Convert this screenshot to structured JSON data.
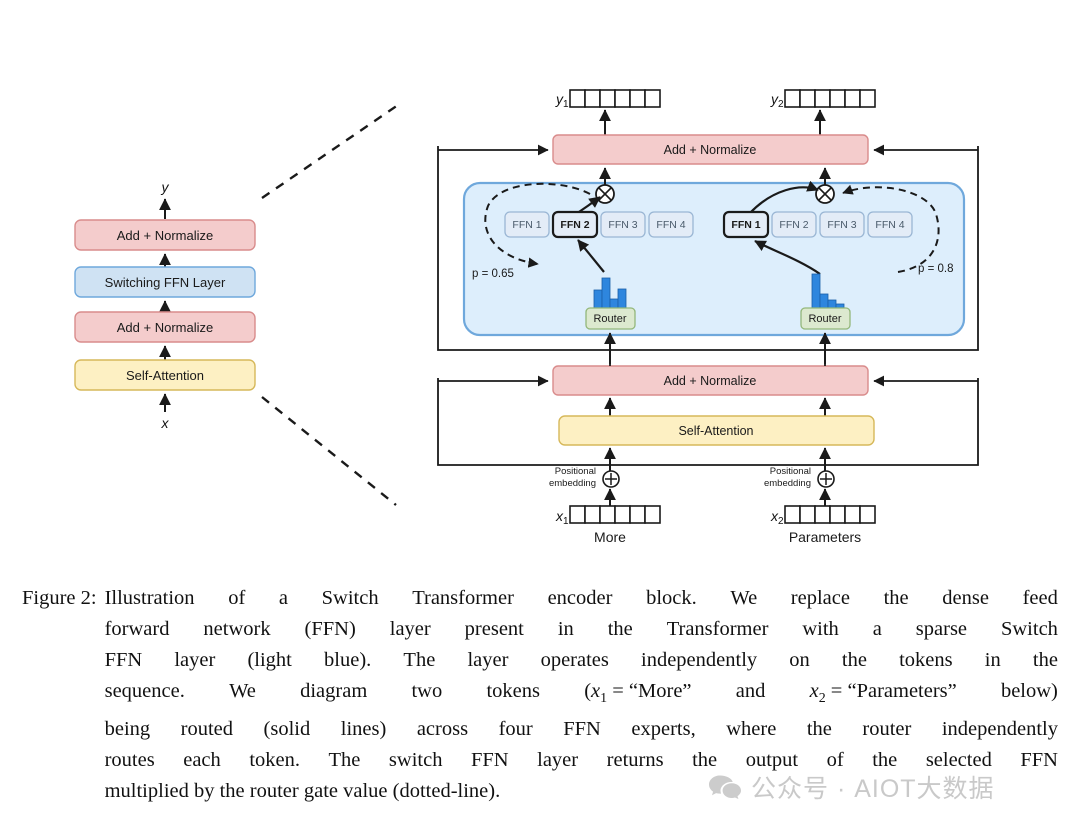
{
  "figure": {
    "left_diagram": {
      "output_label": "y",
      "input_label": "x",
      "blocks": [
        {
          "label": "Add + Normalize",
          "color": "#f4cccc"
        },
        {
          "label": "Switching FFN Layer",
          "color": "#cfe2f3"
        },
        {
          "label": "Add + Normalize",
          "color": "#f4cccc"
        },
        {
          "label": "Self-Attention",
          "color": "#fdf0c3"
        }
      ]
    },
    "right_diagram": {
      "outputs": [
        {
          "label": "y",
          "sub": "1",
          "cells": 6
        },
        {
          "label": "y",
          "sub": "2",
          "cells": 6
        }
      ],
      "inputs": [
        {
          "label": "x",
          "sub": "1",
          "cells": 6,
          "token": "More"
        },
        {
          "label": "x",
          "sub": "2",
          "cells": 6,
          "token": "Parameters"
        }
      ],
      "top_add_norm": "Add + Normalize",
      "bottom_add_norm": "Add + Normalize",
      "self_attention": "Self-Attention",
      "positional_embedding": [
        "Positional",
        "embedding"
      ],
      "router_label": "Router",
      "switch_ffn_layer_color": "#ddeefc",
      "experts_left": [
        {
          "label": "FFN 1",
          "selected": false
        },
        {
          "label": "FFN 2",
          "selected": true
        },
        {
          "label": "FFN 3",
          "selected": false
        },
        {
          "label": "FFN 4",
          "selected": false
        }
      ],
      "experts_right": [
        {
          "label": "FFN 1",
          "selected": true
        },
        {
          "label": "FFN 2",
          "selected": false
        },
        {
          "label": "FFN 3",
          "selected": false
        },
        {
          "label": "FFN 4",
          "selected": false
        }
      ],
      "gate_left": "p = 0.65",
      "gate_right": "p = 0.8",
      "router_hist_left": [
        0.55,
        1.0,
        0.28,
        0.62
      ],
      "router_hist_right": [
        1.0,
        0.4,
        0.22,
        0.1
      ],
      "multiply_symbol": "⊗",
      "plus_symbol": "⊕"
    },
    "colors": {
      "pink": "#f4cccc",
      "pink_stroke": "#d98c8c",
      "yellow": "#fdf0c3",
      "yellow_stroke": "#d6b85a",
      "light_blue": "#ddeefc",
      "light_blue_stroke": "#6fa8dc",
      "expert_fill": "#e3ecf7",
      "expert_stroke": "#9ab6d4",
      "green": "#dce9cf",
      "green_stroke": "#93b77a",
      "bar_blue": "#2e86de",
      "line": "#1a1a1a"
    }
  },
  "caption": {
    "label": "Figure 2:",
    "lines": [
      "Illustration of a Switch Transformer encoder block.  We replace the dense feed",
      "forward network (FFN) layer present in the Transformer with a sparse Switch",
      "FFN layer (light blue).  The layer operates independently on the tokens in the",
      "sequence. We diagram two tokens (x1 = “More” and x2 = “Parameters” below)",
      "being routed (solid lines) across four FFN experts, where the router independently",
      "routes each token.  The switch FFN layer returns the output of the selected FFN",
      "multiplied by the router gate value (dotted-line)."
    ]
  },
  "watermark": {
    "text": "公众号 · AIOT大数据"
  }
}
